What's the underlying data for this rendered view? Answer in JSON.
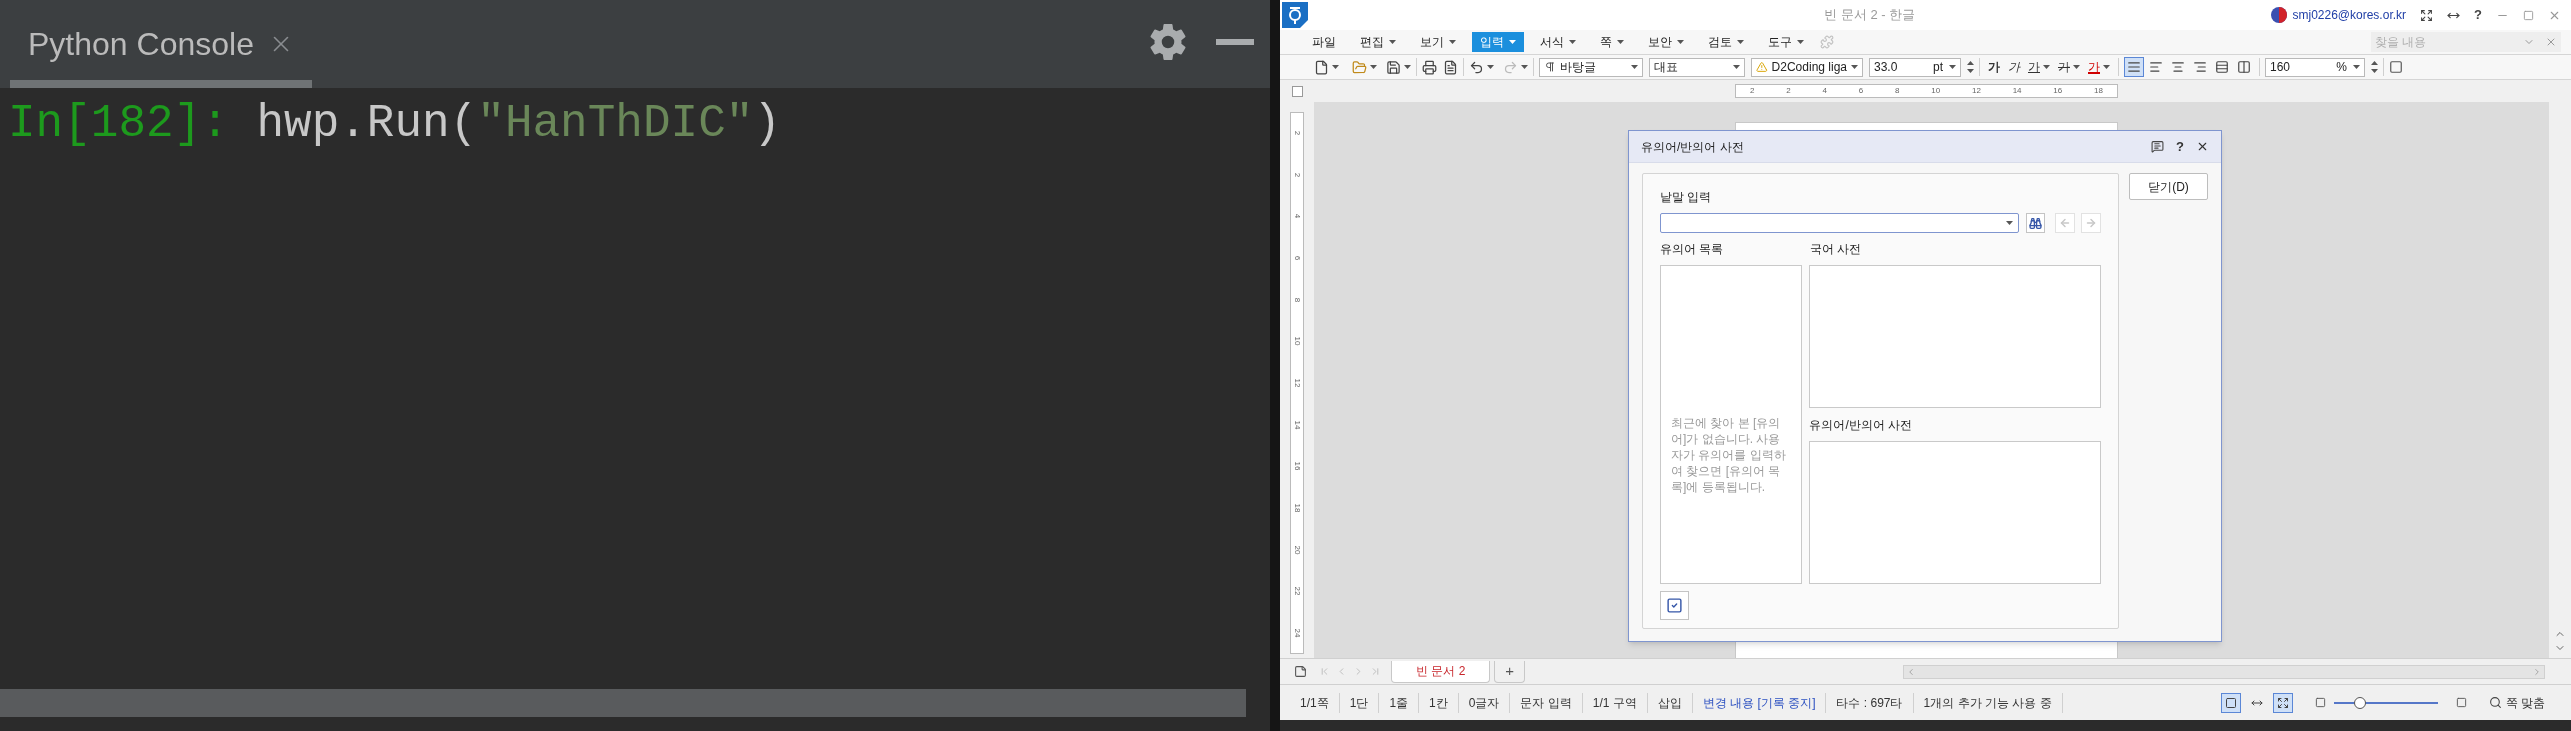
{
  "console": {
    "tab": {
      "label": "Python Console",
      "selected": true
    },
    "prompt": "In[182]:",
    "tokens": [
      {
        "kind": "plain",
        "text": "hwp.Run("
      },
      {
        "kind": "string",
        "text": "\"HanThDIC\""
      },
      {
        "kind": "plain",
        "text": ")"
      }
    ]
  },
  "hwp": {
    "title": "빈 문서 2 - 한글",
    "account": "smj0226@kores.or.kr",
    "help": "?",
    "menu": [
      {
        "label": "파일",
        "dropdown": false,
        "selected": false
      },
      {
        "label": "편집",
        "dropdown": true,
        "selected": false
      },
      {
        "label": "보기",
        "dropdown": true,
        "selected": false
      },
      {
        "label": "입력",
        "dropdown": true,
        "selected": true
      },
      {
        "label": "서식",
        "dropdown": true,
        "selected": false
      },
      {
        "label": "쪽",
        "dropdown": true,
        "selected": false
      },
      {
        "label": "보안",
        "dropdown": true,
        "selected": false
      },
      {
        "label": "검토",
        "dropdown": true,
        "selected": false
      },
      {
        "label": "도구",
        "dropdown": true,
        "selected": false
      }
    ],
    "search": {
      "placeholder": "찾을 내용"
    },
    "toolbar": {
      "style": "바탕글",
      "font_lang": "대표",
      "font": "D2Coding liga",
      "size": "33.0",
      "unit": "pt",
      "char_buttons": [
        {
          "kind": "bold",
          "label": "가"
        },
        {
          "kind": "italic",
          "label": "가"
        },
        {
          "kind": "underline",
          "label": "가"
        },
        {
          "kind": "strike",
          "label": "가"
        },
        {
          "kind": "color",
          "label": "가"
        }
      ],
      "align": [
        {
          "kind": "justify",
          "selected": true
        },
        {
          "kind": "left",
          "selected": false
        },
        {
          "kind": "center",
          "selected": false
        },
        {
          "kind": "right",
          "selected": false
        },
        {
          "kind": "distribute",
          "selected": false
        },
        {
          "kind": "divide",
          "selected": false
        }
      ],
      "zoom": "160",
      "zoom_unit": "%"
    },
    "h_ruler": [
      "2",
      "2",
      "4",
      "6",
      "8",
      "10",
      "12",
      "14",
      "16",
      "18"
    ],
    "v_ruler": [
      "2",
      "2",
      "4",
      "6",
      "8",
      "10",
      "12",
      "14",
      "16",
      "18",
      "20",
      "22",
      "24"
    ],
    "dialog": {
      "title": "유의어/반의어 사전",
      "close_label": "닫기(D)",
      "word_label": "낱말 입력",
      "synonym_list_label": "유의어 목록",
      "korean_dict_label": "국어 사전",
      "thesaurus_label": "유의어/반의어 사전",
      "hint": "최근에 찾아 본 [유의어]가 없습니다. 사용자가 유의어를 입력하여 찾으면 [유의어 목록]에 등록됩니다.",
      "back_disabled": true,
      "forward_disabled": true
    },
    "doc_tabs": [
      {
        "label": "빈 문서 2",
        "selected": true
      }
    ],
    "new_tab": "+",
    "status": [
      {
        "kind": "plain",
        "text": "1/1쪽"
      },
      {
        "kind": "plain",
        "text": "1단"
      },
      {
        "kind": "plain",
        "text": "1줄"
      },
      {
        "kind": "plain",
        "text": "1칸"
      },
      {
        "kind": "plain",
        "text": "0글자"
      },
      {
        "kind": "plain",
        "text": "문자 입력"
      },
      {
        "kind": "plain",
        "text": "1/1 구역"
      },
      {
        "kind": "plain",
        "text": "삽입"
      },
      {
        "kind": "link",
        "text": "변경 내용 [기록 중지]"
      },
      {
        "kind": "plain",
        "text": "타수 : 697타"
      },
      {
        "kind": "plain",
        "text": "1개의 추가 기능 사용 중"
      }
    ],
    "view_modes": [
      {
        "kind": "page",
        "selected": true
      },
      {
        "kind": "width",
        "selected": false
      },
      {
        "kind": "full",
        "selected": true
      }
    ],
    "zoom_slider": {
      "level": 0.25
    },
    "fit_label": "쪽 맞춤"
  }
}
